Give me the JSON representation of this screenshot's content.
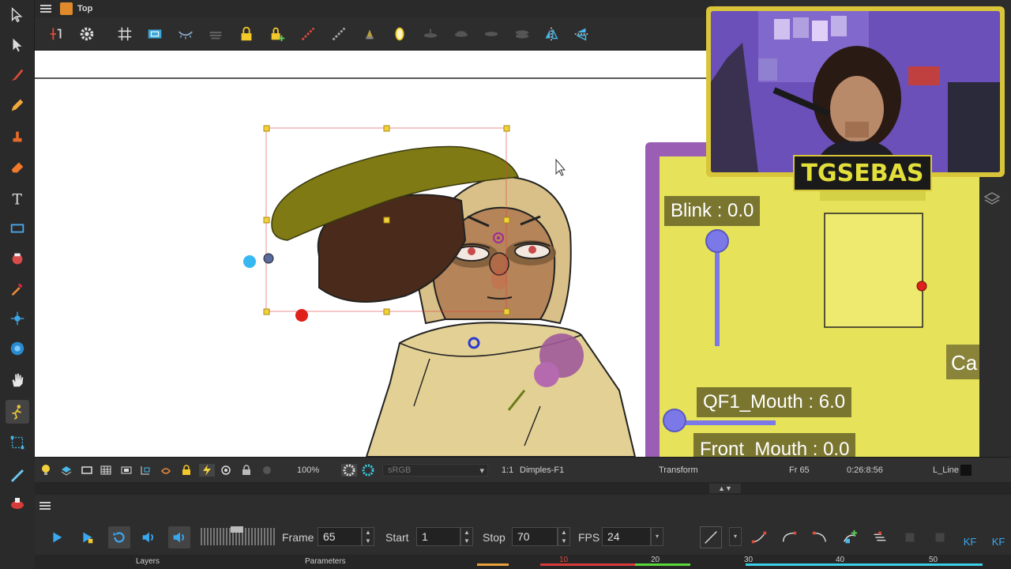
{
  "titlebar": {
    "title": "Top"
  },
  "viewport": {
    "rig_panel": {
      "blink_label": "Blink : 0.0",
      "mouth_label": "QF1_Mouth : 6.0",
      "front_mouth_label": "Front_Mouth : 0.0",
      "cut_label": "Ca"
    }
  },
  "webcam": {
    "streamer_name": "TGSEBAS"
  },
  "statusbar": {
    "zoom": "100%",
    "colorspace": "sRGB",
    "ratio": "1:1",
    "drawing": "Dimples-F1",
    "tool": "Transform",
    "frame": "Fr 65",
    "timecode": "0:26:8:56",
    "layer": "L_Line"
  },
  "timeline": {
    "frame_label": "Frame",
    "frame_value": "65",
    "start_label": "Start",
    "start_value": "1",
    "stop_label": "Stop",
    "stop_value": "70",
    "fps_label": "FPS",
    "fps_value": "24",
    "kf_label": "KF"
  },
  "bottom": {
    "layers_label": "Layers",
    "parameters_label": "Parameters",
    "ruler_ticks": [
      "10",
      "20",
      "30",
      "40",
      "50"
    ]
  },
  "colors": {
    "accent_yellow": "#e6e35a",
    "rig_purple": "#9a5fb5",
    "slider_blue": "#7b78e8"
  }
}
